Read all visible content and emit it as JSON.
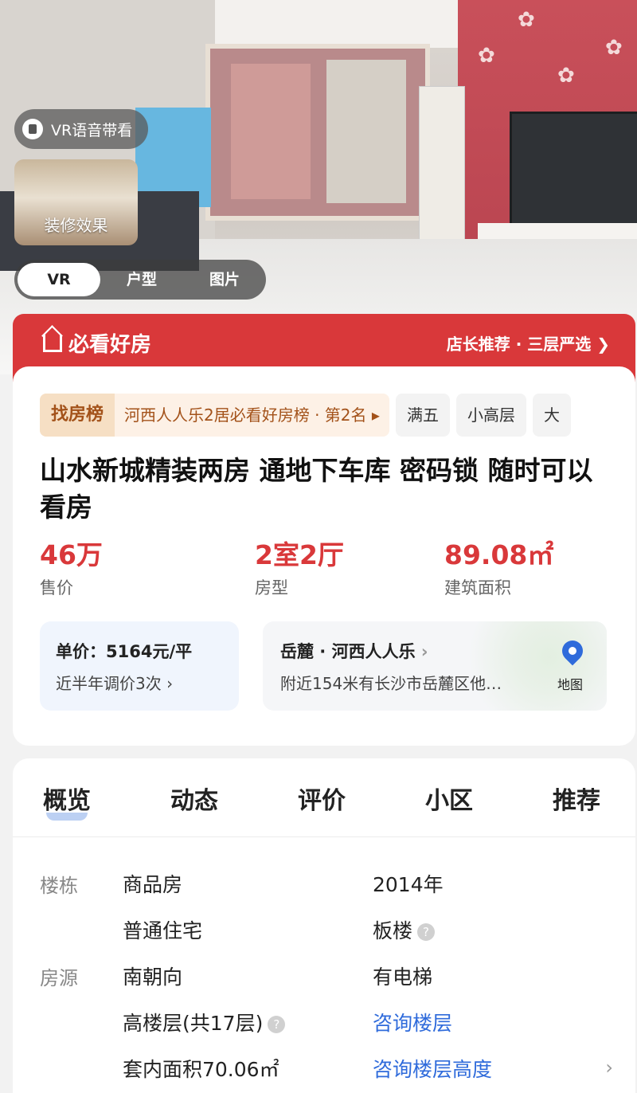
{
  "hero": {
    "vr_chip_label": "VR语音带看",
    "renovation_label": "装修效果",
    "media_tabs": [
      "VR",
      "户型",
      "图片"
    ]
  },
  "banner": {
    "logo_text": "必看好房",
    "recommend_text": "店长推荐 · 三层严选"
  },
  "listing": {
    "rank_badge": "找房榜",
    "rank_text": "河西人人乐2居必看好房榜 · 第2名",
    "tags": [
      "满五",
      "小高层",
      "大"
    ],
    "title": "山水新城精装两房 通地下车库 密码锁 随时可以看房",
    "stats": [
      {
        "value": "46万",
        "label": "售价"
      },
      {
        "value": "2室2厅",
        "label": "房型"
      },
      {
        "value": "89.08㎡",
        "label": "建筑面积"
      }
    ],
    "unit_price": "单价：5164元/平",
    "price_adjust": "近半年调价3次",
    "location": "岳麓 · 河西人人乐",
    "nearby": "附近154米有长沙市岳麓区他…",
    "map_label": "地图"
  },
  "overview": {
    "tabs": [
      "概览",
      "动态",
      "评价",
      "小区",
      "推荐"
    ],
    "building_label": "楼栋",
    "source_label": "房源",
    "building_type": "商品房",
    "build_year": "2014年",
    "usage": "普通住宅",
    "structure": "板楼",
    "orientation": "南朝向",
    "elevator": "有电梯",
    "floor": "高楼层(共17层)",
    "consult_floor": "咨询楼层",
    "inner_area": "套内面积70.06㎡",
    "consult_height": "咨询楼层高度"
  },
  "colors": {
    "brand_red": "#d9383a",
    "link_blue": "#2f6bdb",
    "rank_text": "#a3521a"
  }
}
